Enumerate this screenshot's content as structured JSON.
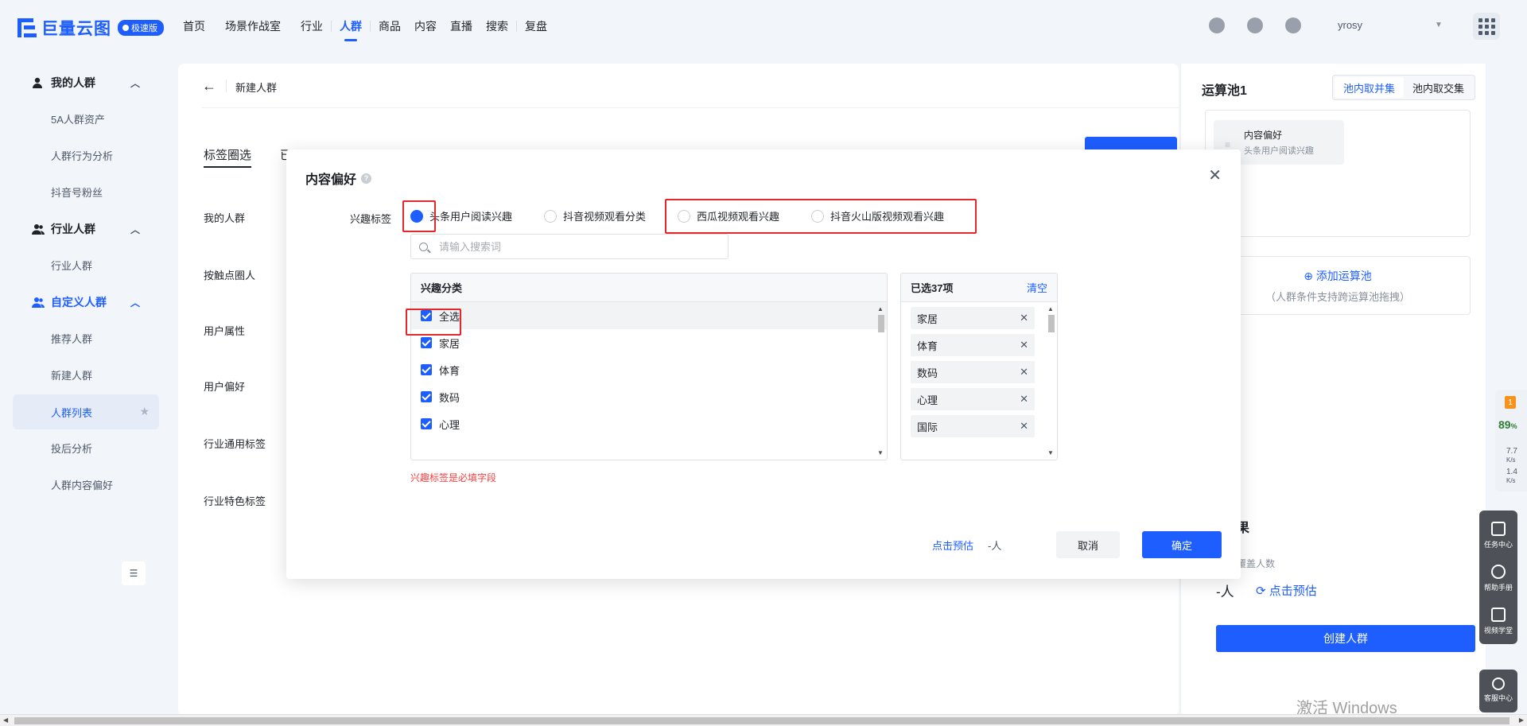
{
  "app": {
    "logo_text": "巨量云图",
    "logo_badge": "极速版",
    "brand_color": "#1e5eff"
  },
  "nav": {
    "items": [
      {
        "label": "首页",
        "active": false
      },
      {
        "label": "场景作战室",
        "active": false
      },
      {
        "label": "行业",
        "active": false
      },
      {
        "label": "人群",
        "active": true
      },
      {
        "label": "商品",
        "active": false
      },
      {
        "label": "内容",
        "active": false
      },
      {
        "label": "直播",
        "active": false
      },
      {
        "label": "搜索",
        "active": false
      },
      {
        "label": "复盘",
        "active": false
      }
    ],
    "user_name": "yrosy"
  },
  "sidebar": {
    "group_my": "我的人群",
    "my_items": [
      "5A人群资产",
      "人群行为分析",
      "抖音号粉丝"
    ],
    "group_industry": "行业人群",
    "industry_items": [
      "行业人群"
    ],
    "group_custom": "自定义人群",
    "custom_items": [
      "推荐人群",
      "新建人群",
      "人群列表",
      "投后分析",
      "人群内容偏好"
    ]
  },
  "main": {
    "page_title": "新建人群",
    "tab_active": "标签圈选",
    "tab_other": "已",
    "field_labels": [
      "我的人群",
      "按触点圈人",
      "用户属性",
      "用户偏好",
      "行业通用标签",
      "行业特色标签"
    ]
  },
  "pool": {
    "title": "运算池1",
    "switch_union": "池内取并集",
    "switch_intersect": "池内取交集",
    "chip_title": "内容偏好",
    "chip_sub": "头条用户阅读兴趣",
    "add_label": "添加运算池",
    "add_hint": "（人群条件支持跨运算池拖拽）",
    "result_title": "果",
    "cover_label": "覆盖人数",
    "cover_value": "-人",
    "estimate_label": "点击预估",
    "create_button": "创建人群"
  },
  "modal": {
    "title": "内容偏好",
    "row_label": "兴趣标签",
    "options": [
      {
        "label": "头条用户阅读兴趣",
        "checked": true
      },
      {
        "label": "抖音视频观看分类",
        "checked": false
      },
      {
        "label": "西瓜视频观看兴趣",
        "checked": false
      },
      {
        "label": "抖音火山版视频观看兴趣",
        "checked": false
      }
    ],
    "search_placeholder": "请输入搜索词",
    "left_panel_title": "兴趣分类",
    "left_items": [
      "全选",
      "家居",
      "体育",
      "数码",
      "心理"
    ],
    "right_panel_title": "已选37项",
    "clear_label": "清空",
    "selected_items": [
      "家居",
      "体育",
      "数码",
      "心理",
      "国际"
    ],
    "error_text": "兴趣标签是必填字段",
    "estimate_link": "点击预估",
    "estimate_value": "-人",
    "cancel_label": "取消",
    "ok_label": "确定"
  },
  "float_tools": {
    "net_badge": "1",
    "net_percent": "89",
    "net_percent_unit": "%",
    "net_up": "7.7",
    "net_down": "1.4",
    "net_unit": "K/s",
    "task_center": "任务中心",
    "help": "帮助手册",
    "video": "视频学堂",
    "service": "客服中心"
  },
  "watermark": {
    "line1": "激活 Windows"
  }
}
